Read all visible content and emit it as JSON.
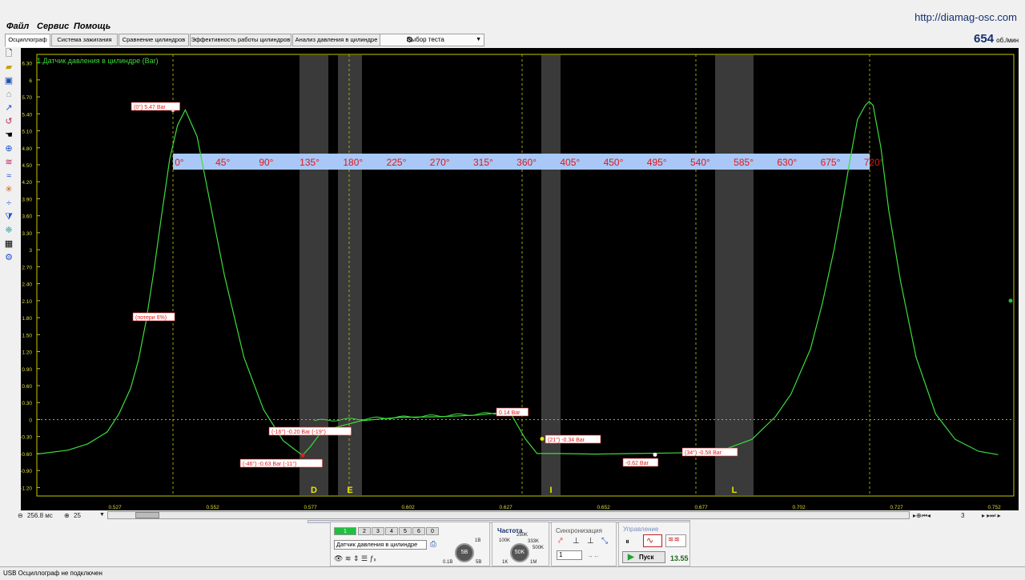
{
  "menu": {
    "file": "Файл",
    "service": "Сервис",
    "help": "Помощь"
  },
  "url": "http://diamag-osc.com",
  "tabs": [
    "Осциллограф",
    "Система зажигания",
    "Сравнение цилиндров",
    "Эффективность работы цилиндров",
    "Анализ давления в цилиндре"
  ],
  "test_select": "Выбор теста",
  "rpm": {
    "value": "654",
    "unit": "об./мин"
  },
  "chart": {
    "channel_label": "1.Датчик давления в цилиндре (Bar)",
    "y_ticks": [
      "6.30",
      "6",
      "5.70",
      "5.40",
      "5.10",
      "4.80",
      "4.50",
      "4.20",
      "3.90",
      "3.60",
      "3.30",
      "3",
      "2.70",
      "2.40",
      "2.10",
      "1.80",
      "1.50",
      "1.20",
      "0.90",
      "0.60",
      "0.30",
      "0",
      "-0.30",
      "-0.60",
      "-0.90",
      "-1.20"
    ],
    "x_ticks": [
      "0.527",
      "0.552",
      "0.577",
      "0.602",
      "0.627",
      "0.652",
      "0.677",
      "0.702",
      "0.727",
      "0.752"
    ],
    "angle_ticks": [
      "0°",
      "45°",
      "90°",
      "135°",
      "180°",
      "225°",
      "270°",
      "315°",
      "360°",
      "405°",
      "450°",
      "495°",
      "540°",
      "585°",
      "630°",
      "675°",
      "720°"
    ],
    "zones": [
      "D",
      "E",
      "I",
      "L"
    ],
    "annotations": [
      "(0°) 5.47 Bar",
      "(потери 6%)",
      "(-16°) -0.20 Bar (-19°)",
      "(-46°) -0.63 Bar (-11°)",
      "0.14 Bar",
      "(21°) -0.34 Bar",
      "-0.62 Bar",
      "(34°) -0.58 Bar"
    ]
  },
  "chart_data": {
    "type": "line",
    "title": "1.Датчик давления в цилиндре (Bar)",
    "xlabel": "",
    "ylabel": "",
    "xlim": [
      0.507,
      0.757
    ],
    "ylim": [
      -1.35,
      6.45
    ],
    "series": [
      {
        "name": "1.Датчик давления в цилиндре (Bar)",
        "x": [
          0.507,
          0.515,
          0.52,
          0.525,
          0.528,
          0.531,
          0.533,
          0.535,
          0.537,
          0.539,
          0.541,
          0.543,
          0.545,
          0.548,
          0.551,
          0.555,
          0.56,
          0.565,
          0.57,
          0.573,
          0.575,
          0.577,
          0.58,
          0.59,
          0.6,
          0.61,
          0.62,
          0.628,
          0.63,
          0.632,
          0.635,
          0.64,
          0.65,
          0.66,
          0.67,
          0.677,
          0.682,
          0.69,
          0.696,
          0.7,
          0.705,
          0.708,
          0.711,
          0.713,
          0.715,
          0.717,
          0.719,
          0.72,
          0.721,
          0.723,
          0.725,
          0.728,
          0.732,
          0.737,
          0.742,
          0.748,
          0.753
        ],
        "values": [
          -0.61,
          -0.54,
          -0.43,
          -0.22,
          0.1,
          0.55,
          1.05,
          1.75,
          2.65,
          3.65,
          4.6,
          5.2,
          5.47,
          5.0,
          3.95,
          2.55,
          1.1,
          0.18,
          -0.37,
          -0.53,
          -0.63,
          -0.48,
          -0.2,
          -0.02,
          0.04,
          0.05,
          0.08,
          0.14,
          -0.1,
          -0.34,
          -0.6,
          -0.6,
          -0.61,
          -0.6,
          -0.59,
          -0.58,
          -0.55,
          -0.35,
          0.05,
          0.45,
          1.25,
          2.05,
          3.0,
          3.75,
          4.55,
          5.3,
          5.55,
          5.62,
          5.55,
          4.8,
          3.7,
          2.45,
          1.1,
          0.1,
          -0.35,
          -0.56,
          -0.62
        ]
      }
    ]
  },
  "bottom": {
    "timebase": "256.8 мс",
    "zoom": "25",
    "page": "3"
  },
  "panel": {
    "channels": [
      "1",
      "2",
      "3",
      "4",
      "5",
      "6",
      "0"
    ],
    "sensor": "Датчик давления в цилиндре",
    "scale_knob": "5В",
    "scale_min": "0.1В",
    "scale_max": "1В",
    "scale_mid": "5В",
    "freq_title": "Частота",
    "freq_knob": "50K",
    "freq_labels": [
      "100K",
      "250K",
      "333K",
      "500K",
      "1K",
      "1M"
    ],
    "sync_title": "Синхронизация",
    "sync_value": "1",
    "control_title": "Управление",
    "start": "Пуск",
    "value": "13.55"
  },
  "status": "USB Осциллограф не подключен",
  "colors": {
    "trace": "#3cdc3c",
    "annotation": "#e02020",
    "angle_band": "#a9c8f7",
    "gridline": "#e8e800"
  }
}
